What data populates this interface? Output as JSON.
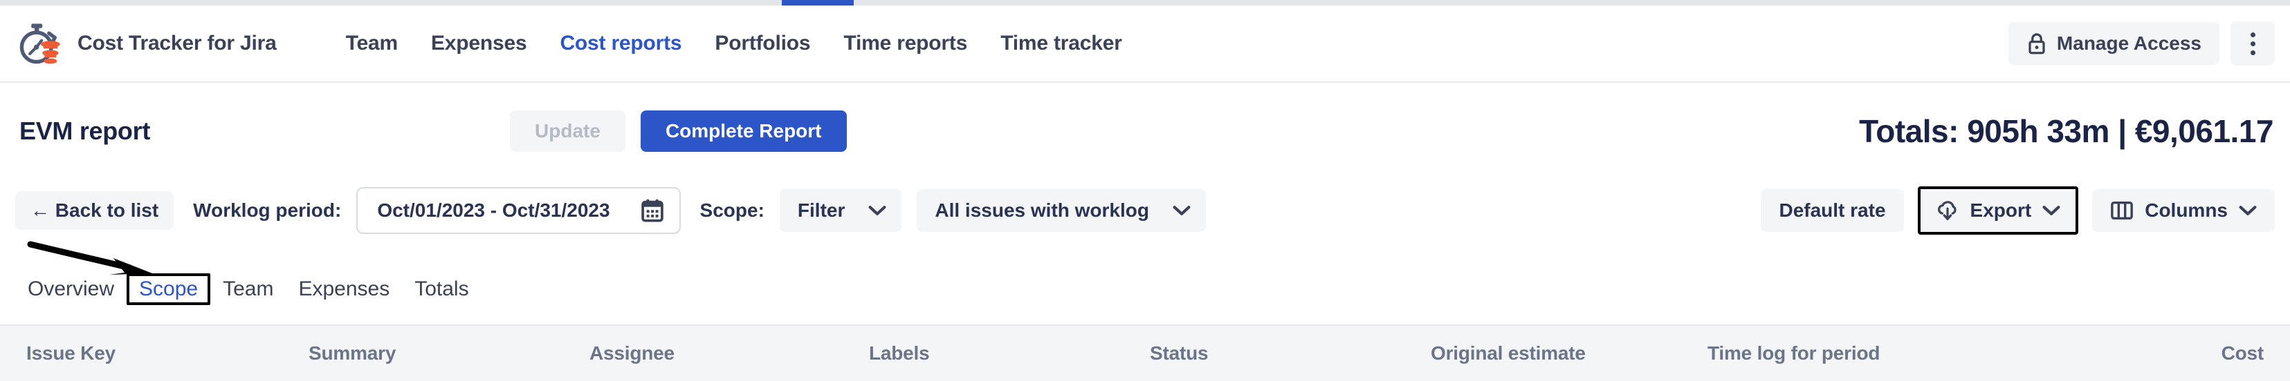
{
  "colors": {
    "accent_blue": "#2c55c8",
    "text_dark": "#1b2447",
    "text_nav": "#3b4257",
    "muted_grey": "#b6bac6",
    "header_grey": "#6b7489",
    "chip_bg": "#f4f5f7",
    "logo_orange": "#ef5b34",
    "annotation_black": "#000000"
  },
  "topbar": {
    "indicator": "loading-progress-bar"
  },
  "header": {
    "logo_icon": "stopwatch-coin-icon",
    "brand": "Cost Tracker for Jira",
    "nav": [
      {
        "label": "Team",
        "active": false
      },
      {
        "label": "Expenses",
        "active": false
      },
      {
        "label": "Cost reports",
        "active": true
      },
      {
        "label": "Portfolios",
        "active": false
      },
      {
        "label": "Time reports",
        "active": false
      },
      {
        "label": "Time tracker",
        "active": false
      }
    ],
    "manage_access": {
      "label": "Manage Access",
      "icon": "lock-icon"
    },
    "kebab_icon": "more-vertical-icon"
  },
  "title_row": {
    "title": "EVM report",
    "update_label": "Update",
    "complete_report_label": "Complete Report",
    "totals": "Totals: 905h 33m | €9,061.17"
  },
  "filter_row": {
    "back_to_list": "← Back to list",
    "worklog_label": "Worklog period:",
    "worklog_value": "Oct/01/2023 - Oct/31/2023",
    "calendar_icon": "calendar-icon",
    "scope_label": "Scope:",
    "filter_select": "Filter",
    "issues_select": "All issues with worklog",
    "default_rate": "Default rate",
    "export": "Export",
    "export_icon": "cloud-download-icon",
    "columns": "Columns",
    "columns_icon": "columns-icon",
    "chevron_icon": "chevron-down-icon"
  },
  "tabs": [
    {
      "label": "Overview",
      "active": false
    },
    {
      "label": "Scope",
      "active": true
    },
    {
      "label": "Team",
      "active": false
    },
    {
      "label": "Expenses",
      "active": false
    },
    {
      "label": "Totals",
      "active": false
    }
  ],
  "annotation": {
    "arrow": "pointer-arrow-to-scope-tab"
  },
  "table": {
    "columns": [
      "Issue Key",
      "Summary",
      "Assignee",
      "Labels",
      "Status",
      "Original estimate",
      "Time log for period",
      "Cost"
    ],
    "rows": []
  }
}
